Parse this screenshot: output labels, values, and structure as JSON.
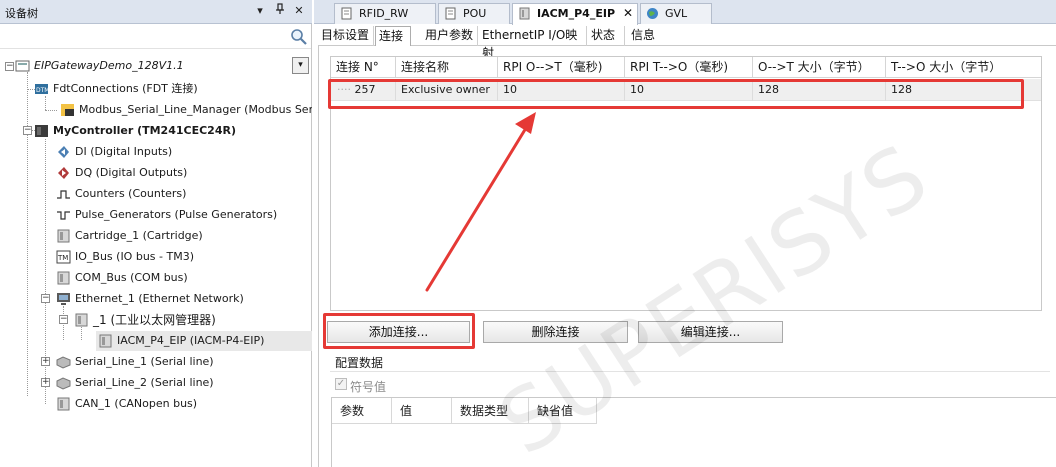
{
  "left_panel": {
    "title": "设备树",
    "pin_icon": "pin-icon",
    "close_glyph": "✕",
    "dropdown_glyph": "▾",
    "tree": [
      {
        "label": "EIPGatewayDemo_128V1.1",
        "icon": "project-icon",
        "style": "italic"
      },
      {
        "label": "FdtConnections (FDT 连接)",
        "icon": "fdt-icon"
      },
      {
        "label": "Modbus_Serial_Line_Manager (Modbus Serial Line Manager)",
        "icon": "modbus-icon"
      },
      {
        "label": "MyController (TM241CEC24R)",
        "icon": "controller-icon",
        "style": "bold"
      },
      {
        "label": "DI (Digital Inputs)",
        "icon": "digital-input-icon"
      },
      {
        "label": "DQ (Digital Outputs)",
        "icon": "digital-output-icon"
      },
      {
        "label": "Counters (Counters)",
        "icon": "counter-icon"
      },
      {
        "label": "Pulse_Generators (Pulse Generators)",
        "icon": "pulse-icon"
      },
      {
        "label": "Cartridge_1 (Cartridge)",
        "icon": "module-icon"
      },
      {
        "label": "IO_Bus (IO bus - TM3)",
        "icon": "io-bus-icon"
      },
      {
        "label": "COM_Bus (COM bus)",
        "icon": "module-icon"
      },
      {
        "label": "Ethernet_1 (Ethernet Network)",
        "icon": "ethernet-icon"
      },
      {
        "label": "_1 (工业以太网管理器)",
        "icon": "module-icon"
      },
      {
        "label": "IACM_P4_EIP (IACM-P4-EIP)",
        "icon": "module-icon"
      },
      {
        "label": "Serial_Line_1 (Serial line)",
        "icon": "serial-icon"
      },
      {
        "label": "Serial_Line_2 (Serial line)",
        "icon": "serial-icon"
      },
      {
        "label": "CAN_1 (CANopen bus)",
        "icon": "module-icon"
      }
    ]
  },
  "doc_tabs": [
    {
      "label": "RFID_RW",
      "icon": "document-icon"
    },
    {
      "label": "POU",
      "icon": "document-icon"
    },
    {
      "label": "IACM_P4_EIP",
      "icon": "module-icon",
      "active": true,
      "close": "✕"
    },
    {
      "label": "GVL",
      "icon": "globe-icon"
    }
  ],
  "sub_tabs": [
    {
      "label": "目标设置"
    },
    {
      "label": "连接",
      "active": true
    },
    {
      "label": "用户参数"
    },
    {
      "label": "EthernetIP I/O映射"
    },
    {
      "label": "状态"
    },
    {
      "label": "信息"
    }
  ],
  "connections": {
    "headers": [
      "连接 N°",
      "连接名称",
      "RPI O-->T（毫秒)",
      "RPI T-->O（毫秒)",
      "O-->T 大小（字节）",
      "T-->O 大小（字节）"
    ],
    "rows": [
      [
        "257",
        "Exclusive owner",
        "10",
        "10",
        "128",
        "128"
      ]
    ]
  },
  "buttons": {
    "add": "添加连接...",
    "delete": "删除连接",
    "edit": "编辑连接..."
  },
  "config": {
    "title": "配置数据",
    "symbol_check": "✓",
    "symbol_label": "符号值",
    "headers": [
      "参数",
      "值",
      "数据类型",
      "缺省值"
    ]
  },
  "watermark": "SUPERISYS",
  "colors": {
    "highlight": "#e53935",
    "title_bar": "#dde4ef"
  }
}
